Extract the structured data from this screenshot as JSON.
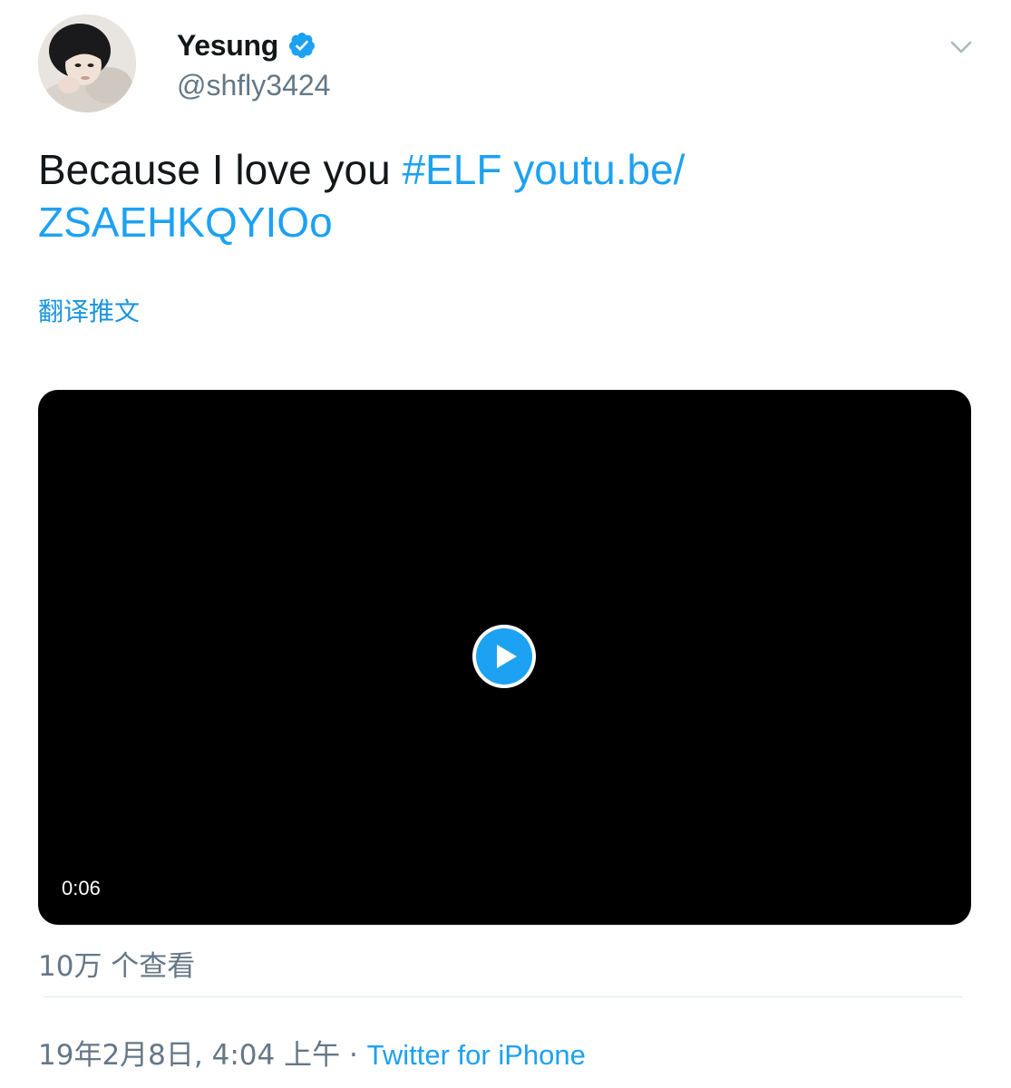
{
  "author": {
    "display_name": "Yesung",
    "handle": "@shfly3424",
    "verified": true,
    "avatar_icon": "profile-photo"
  },
  "menu": {
    "icon": "chevron-down-icon"
  },
  "tweet": {
    "text_plain": "Because I love you ",
    "hashtag": "#ELF",
    "link_part1": "youtu.be/",
    "link_part2": "ZSAEHKQYIOo",
    "translate_label": "翻译推文"
  },
  "video": {
    "duration": "0:06",
    "play_icon": "play-icon"
  },
  "stats": {
    "views": "10万 个查看"
  },
  "meta": {
    "timestamp": "19年2月8日, 4:04 上午",
    "separator": "·",
    "source": "Twitter for iPhone"
  },
  "colors": {
    "link": "#1da1f2",
    "text": "#14171a",
    "secondary": "#657786",
    "divider": "#e1e8ed",
    "video_bg": "#000000"
  }
}
